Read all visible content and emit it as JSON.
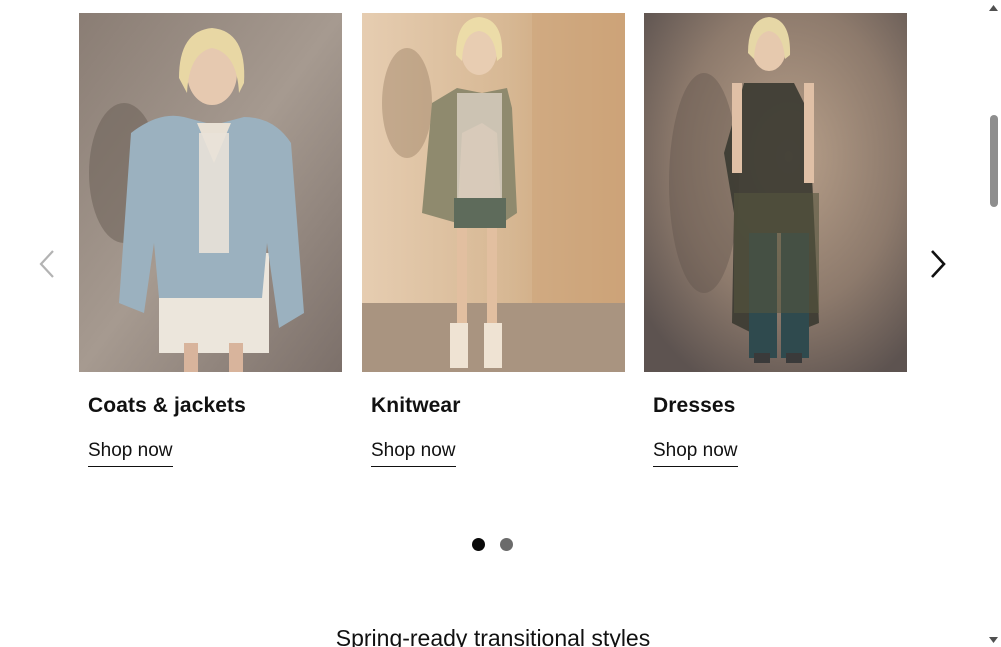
{
  "carousel": {
    "prev_icon": "chevron-left-icon",
    "next_icon": "chevron-right-icon",
    "cards": [
      {
        "title": "Coats & jackets",
        "link": "Shop now",
        "image": "model-denim-jacket"
      },
      {
        "title": "Knitwear",
        "link": "Shop now",
        "image": "model-knit-cardigan"
      },
      {
        "title": "Dresses",
        "link": "Shop now",
        "image": "model-sheer-dress"
      }
    ],
    "pagination": {
      "current": 1,
      "total": 2
    }
  },
  "section": {
    "heading": "Spring-ready transitional styles"
  },
  "colors": {
    "text": "#111111",
    "dot_active": "#0a0a0a",
    "dot_inactive": "#6b6b6b",
    "arrow_disabled": "#b3b3b3",
    "scroll_thumb": "#8e8e8e"
  }
}
